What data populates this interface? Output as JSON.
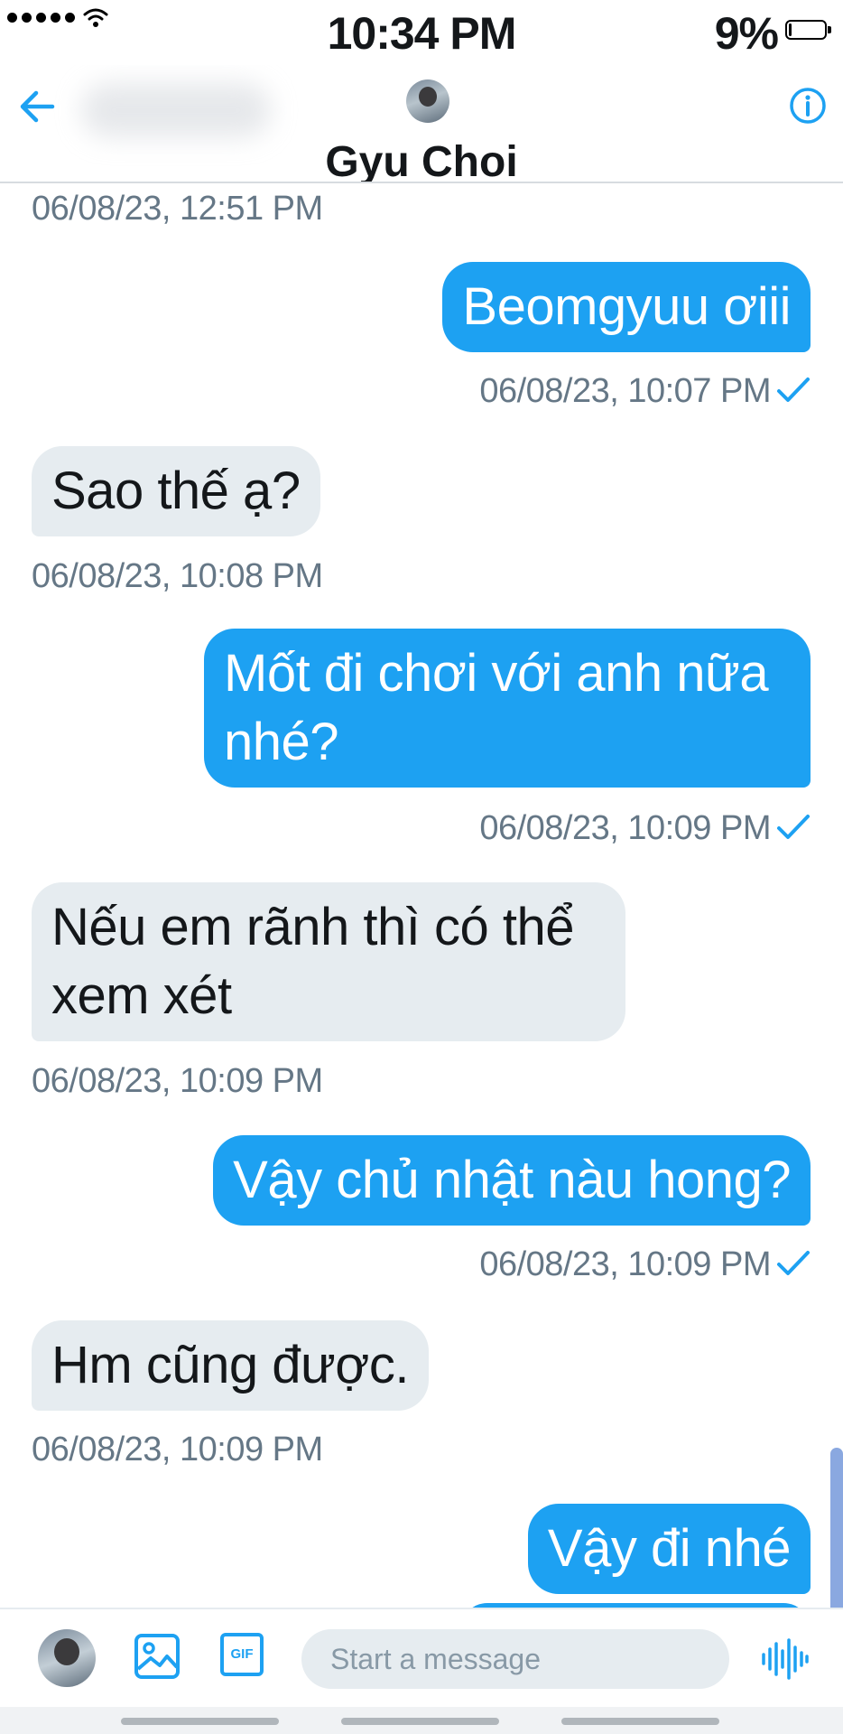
{
  "status_bar": {
    "time": "10:34 PM",
    "battery": "9%",
    "battery_level": 0.09
  },
  "header": {
    "name": "Gyu Choi"
  },
  "messages": [
    {
      "dir": "in",
      "text": "",
      "time": "06/08/23, 12:51 PM"
    },
    {
      "dir": "out",
      "text": "Beomgyuu ơiii",
      "time": "06/08/23, 10:07 PM"
    },
    {
      "dir": "in",
      "text": "Sao thế ạ?",
      "time": "06/08/23, 10:08 PM"
    },
    {
      "dir": "out",
      "text": "Mốt đi chơi với anh nữa nhé?",
      "time": "06/08/23, 10:09 PM"
    },
    {
      "dir": "in",
      "text": "Nếu em rãnh thì có thể xem xét",
      "time": "06/08/23, 10:09 PM"
    },
    {
      "dir": "out",
      "text": "Vậy chủ nhật nàu hong?",
      "time": "06/08/23, 10:09 PM"
    },
    {
      "dir": "in",
      "text": "Hm cũng được.",
      "time": "06/08/23, 10:09 PM"
    },
    {
      "dir": "out",
      "text": "Vậy đi nhé",
      "time": ""
    }
  ],
  "composer": {
    "placeholder": "Start a message",
    "gif_label": "GIF"
  },
  "colors": {
    "accent": "#1da1f2",
    "incoming_bubble": "#e6ecf0",
    "timestamp": "#657786"
  },
  "icons": [
    "back-arrow-icon",
    "info-icon",
    "read-check-icon",
    "image-icon",
    "gif-icon",
    "voice-wave-icon"
  ]
}
